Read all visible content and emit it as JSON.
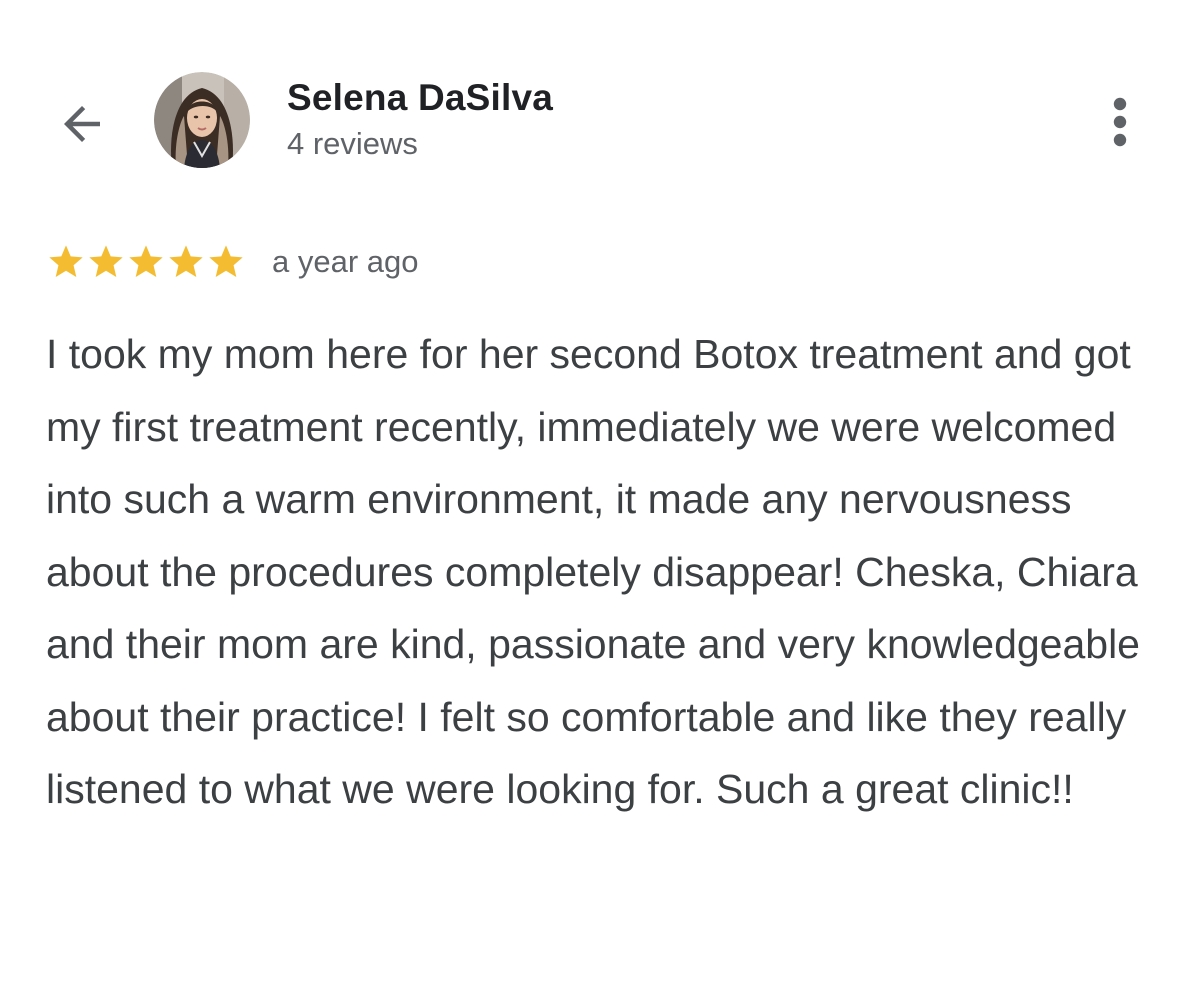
{
  "header": {
    "back_icon": "arrow-left-icon",
    "avatar_icon": "profile-photo",
    "reviewer_name": "Selena DaSilva",
    "review_count": "4 reviews",
    "more_icon": "more-vert-icon"
  },
  "review": {
    "rating": 5,
    "rating_max": 5,
    "time_ago": "a year ago",
    "text": "I took my mom here for her second Botox treatment and got my first treatment recently, immediately we were welcomed into such a warm environment, it made any nervousness about the procedures completely disappear! Cheska, Chiara and their mom are kind, passionate and very knowledgeable about their practice! I felt so comfortable and like they really listened to what we were looking for. Such a great clinic!!"
  },
  "colors": {
    "star": "#F4BC30",
    "star_empty": "#DADCE0",
    "text_primary": "#202124",
    "text_body": "#3c4043",
    "text_secondary": "#5f6368",
    "icon": "#5f6368"
  }
}
